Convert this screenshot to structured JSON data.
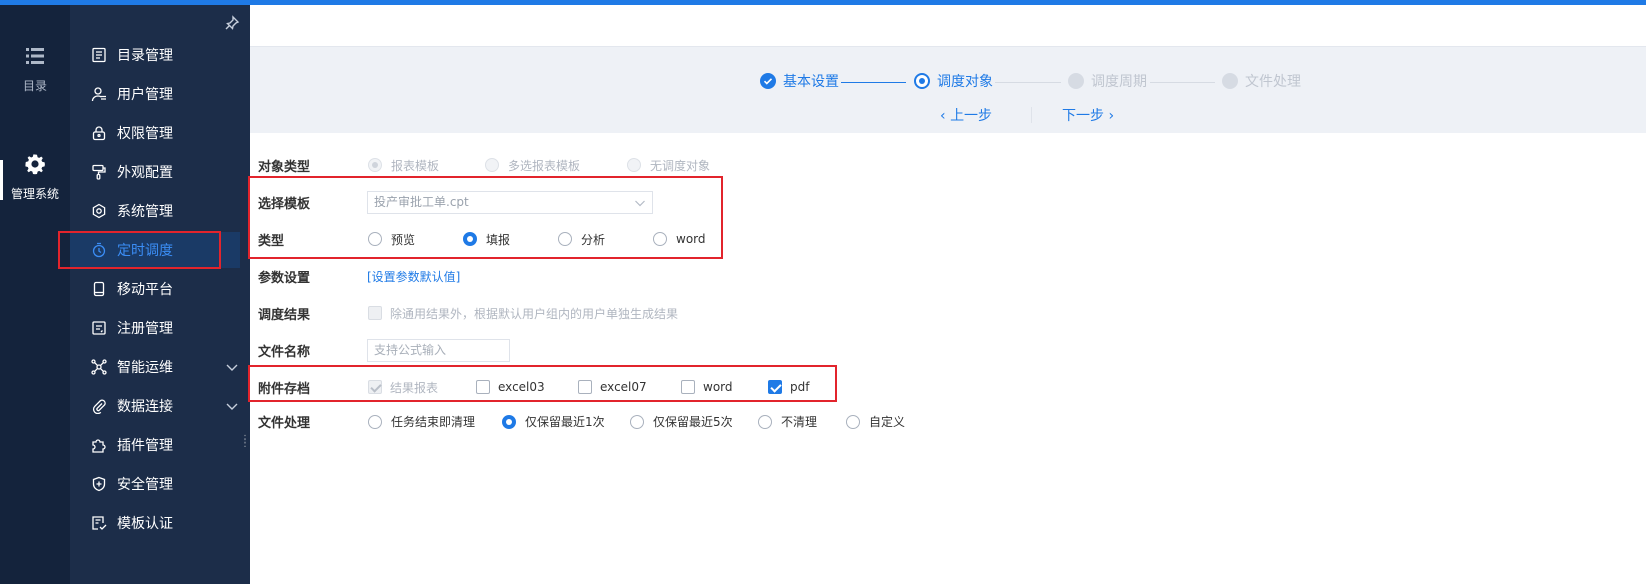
{
  "rail": {
    "catalog_label": "目录",
    "system_label": "管理系统"
  },
  "nav": {
    "items": [
      {
        "label": "目录管理"
      },
      {
        "label": "用户管理"
      },
      {
        "label": "权限管理"
      },
      {
        "label": "外观配置"
      },
      {
        "label": "系统管理"
      },
      {
        "label": "定时调度"
      },
      {
        "label": "移动平台"
      },
      {
        "label": "注册管理"
      },
      {
        "label": "智能运维"
      },
      {
        "label": "数据连接"
      },
      {
        "label": "插件管理"
      },
      {
        "label": "安全管理"
      },
      {
        "label": "模板认证"
      }
    ]
  },
  "steps": [
    {
      "label": "基本设置",
      "state": "done"
    },
    {
      "label": "调度对象",
      "state": "current"
    },
    {
      "label": "调度周期",
      "state": "future"
    },
    {
      "label": "文件处理",
      "state": "future"
    }
  ],
  "pager": {
    "prev": "上一步",
    "next": "下一步"
  },
  "form": {
    "object_type": {
      "label": "对象类型",
      "options": [
        "报表模板",
        "多选报表模板",
        "无调度对象"
      ],
      "selected": "报表模板"
    },
    "template": {
      "label": "选择模板",
      "value": "投产审批工单.cpt"
    },
    "type": {
      "label": "类型",
      "options": [
        "预览",
        "填报",
        "分析",
        "word"
      ],
      "selected": "填报"
    },
    "params": {
      "label": "参数设置",
      "link": "[设置参数默认值]"
    },
    "result": {
      "label": "调度结果",
      "text": "除通用结果外，根据默认用户组内的用户单独生成结果"
    },
    "filename": {
      "label": "文件名称",
      "placeholder": "支持公式输入"
    },
    "attachment": {
      "label": "附件存档",
      "options": [
        "结果报表",
        "excel03",
        "excel07",
        "word",
        "pdf"
      ],
      "checked": [
        "结果报表",
        "pdf"
      ]
    },
    "file_processing": {
      "label": "文件处理",
      "options": [
        "任务结束即清理",
        "仅保留最近1次",
        "仅保留最近5次",
        "不清理",
        "自定义"
      ],
      "selected": "仅保留最近1次"
    }
  },
  "colors": {
    "accent": "#1f7ae6",
    "sidebar": "#1c2d49",
    "rail": "#14233c",
    "highlight_box": "#e2242c"
  }
}
